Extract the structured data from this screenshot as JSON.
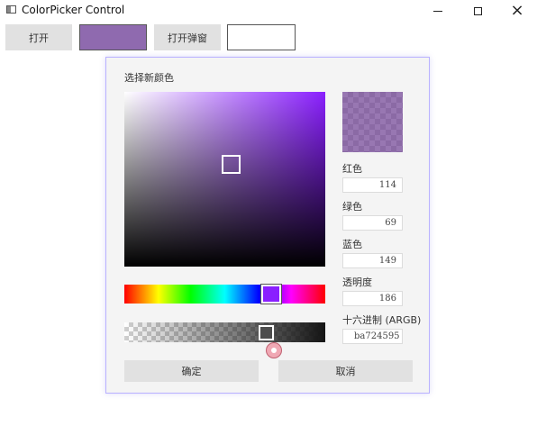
{
  "window": {
    "title": "ColorPicker Control",
    "minimize_glyph": "minimize-icon",
    "maximize_glyph": "maximize-icon",
    "close_glyph": "×"
  },
  "toolbar": {
    "open_label": "打开",
    "open_popup_label": "打开弹窗",
    "selected_color": "#8f6aaf",
    "second_swatch_color": "#ffffff"
  },
  "picker": {
    "title": "选择新颜色",
    "hue_color": "#8a1fff",
    "red_label": "红色",
    "red_value": "114",
    "green_label": "绿色",
    "green_value": "69",
    "blue_label": "蓝色",
    "blue_value": "149",
    "alpha_label": "透明度",
    "alpha_value": "186",
    "hex_label": "十六进制 (ARGB)",
    "hex_value": "ba724595",
    "ok_label": "确定",
    "cancel_label": "取消",
    "preview_color": "#724595",
    "accent_border": "#b9b1ff"
  }
}
